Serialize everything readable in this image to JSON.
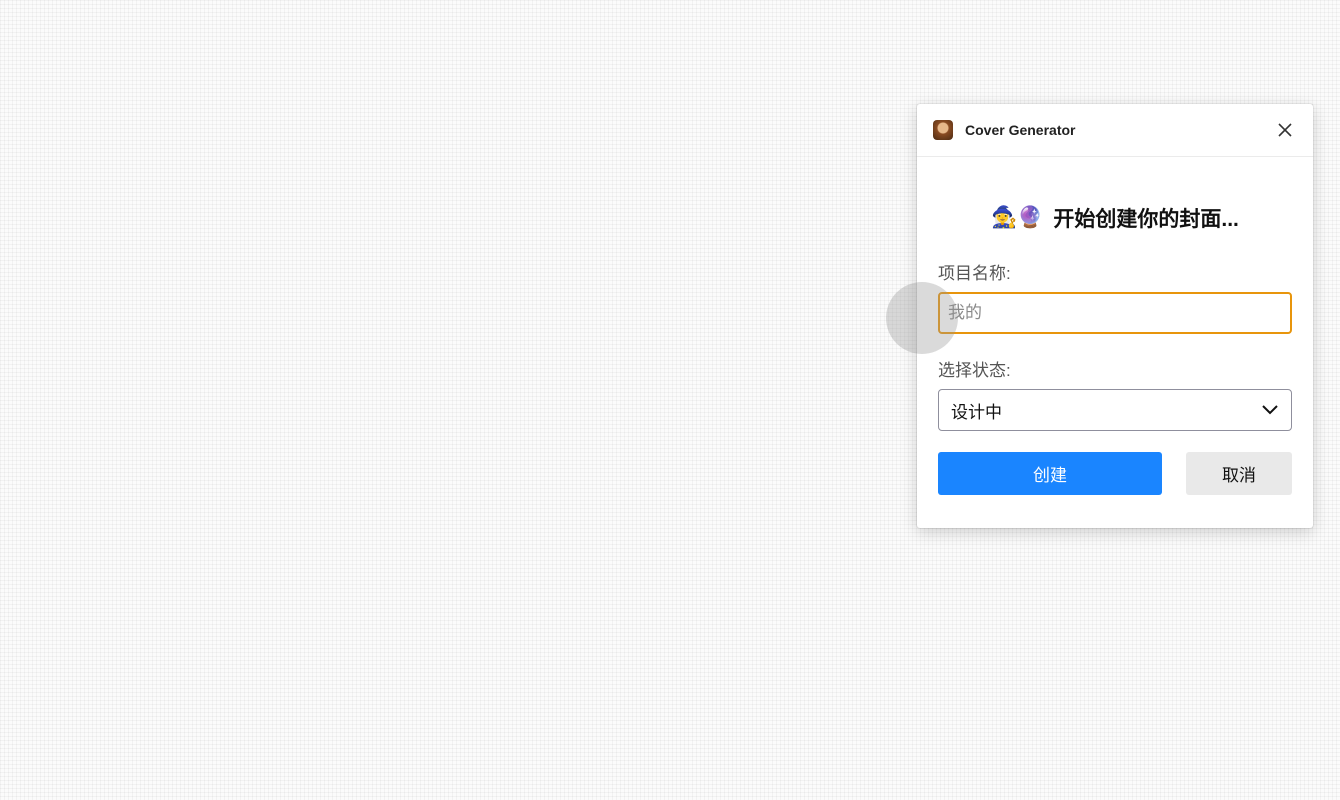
{
  "plugin": {
    "title": "Cover Generator",
    "icon": "portrait-app-icon",
    "close_icon": "close-icon"
  },
  "form": {
    "heading_emoji": "🧙‍♀️🔮",
    "heading_text": "开始创建你的封面...",
    "project_name_label": "项目名称:",
    "project_name_placeholder": "我的",
    "project_name_value": "",
    "status_label": "选择状态:",
    "status_selected": "设计中"
  },
  "actions": {
    "create_label": "创建",
    "cancel_label": "取消"
  },
  "colors": {
    "primary": "#1a85ff",
    "focus_border": "#e8950c",
    "secondary_bg": "#e9e9e9"
  }
}
